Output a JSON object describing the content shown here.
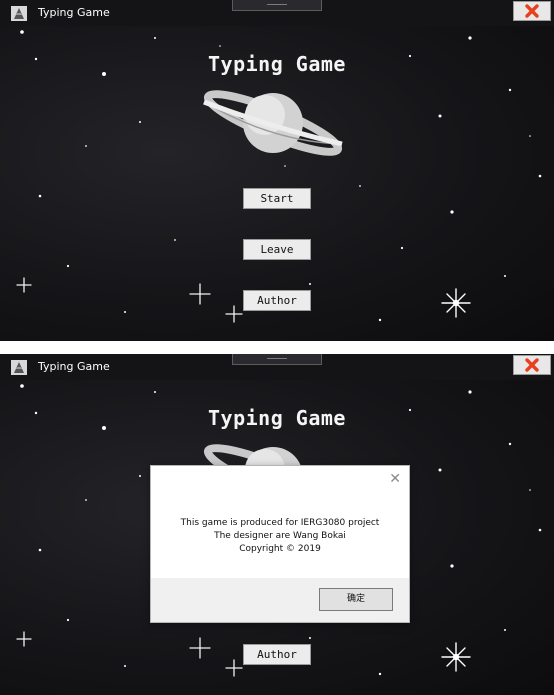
{
  "window": {
    "title": "Typing Game"
  },
  "game": {
    "title": "Typing Game",
    "buttons": {
      "start": "Start",
      "leave": "Leave",
      "author": "Author"
    }
  },
  "dialog": {
    "line1": "This game is produced for IERG3080 project",
    "line2": "The designer are Wang Bokai",
    "line3": "Copyright © 2019",
    "ok_label": "确定"
  },
  "colors": {
    "background": "#0e0e10",
    "close_icon": "#e8401c",
    "button_bg": "#ececec",
    "dialog_footer": "#f0f0f0"
  },
  "icons": {
    "app": "app-icon",
    "close": "close-icon",
    "planet": "planet-illustration"
  }
}
